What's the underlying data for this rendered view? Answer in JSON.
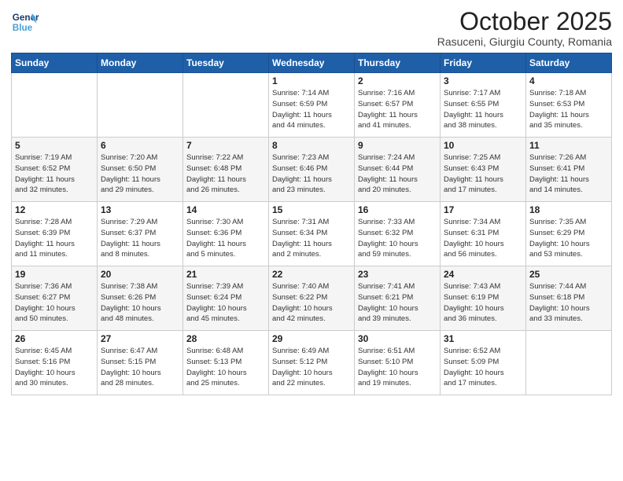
{
  "logo": {
    "line1": "General",
    "line2": "Blue"
  },
  "header": {
    "month": "October 2025",
    "location": "Rasuceni, Giurgiu County, Romania"
  },
  "weekdays": [
    "Sunday",
    "Monday",
    "Tuesday",
    "Wednesday",
    "Thursday",
    "Friday",
    "Saturday"
  ],
  "weeks": [
    [
      {
        "day": "",
        "info": ""
      },
      {
        "day": "",
        "info": ""
      },
      {
        "day": "",
        "info": ""
      },
      {
        "day": "1",
        "info": "Sunrise: 7:14 AM\nSunset: 6:59 PM\nDaylight: 11 hours\nand 44 minutes."
      },
      {
        "day": "2",
        "info": "Sunrise: 7:16 AM\nSunset: 6:57 PM\nDaylight: 11 hours\nand 41 minutes."
      },
      {
        "day": "3",
        "info": "Sunrise: 7:17 AM\nSunset: 6:55 PM\nDaylight: 11 hours\nand 38 minutes."
      },
      {
        "day": "4",
        "info": "Sunrise: 7:18 AM\nSunset: 6:53 PM\nDaylight: 11 hours\nand 35 minutes."
      }
    ],
    [
      {
        "day": "5",
        "info": "Sunrise: 7:19 AM\nSunset: 6:52 PM\nDaylight: 11 hours\nand 32 minutes."
      },
      {
        "day": "6",
        "info": "Sunrise: 7:20 AM\nSunset: 6:50 PM\nDaylight: 11 hours\nand 29 minutes."
      },
      {
        "day": "7",
        "info": "Sunrise: 7:22 AM\nSunset: 6:48 PM\nDaylight: 11 hours\nand 26 minutes."
      },
      {
        "day": "8",
        "info": "Sunrise: 7:23 AM\nSunset: 6:46 PM\nDaylight: 11 hours\nand 23 minutes."
      },
      {
        "day": "9",
        "info": "Sunrise: 7:24 AM\nSunset: 6:44 PM\nDaylight: 11 hours\nand 20 minutes."
      },
      {
        "day": "10",
        "info": "Sunrise: 7:25 AM\nSunset: 6:43 PM\nDaylight: 11 hours\nand 17 minutes."
      },
      {
        "day": "11",
        "info": "Sunrise: 7:26 AM\nSunset: 6:41 PM\nDaylight: 11 hours\nand 14 minutes."
      }
    ],
    [
      {
        "day": "12",
        "info": "Sunrise: 7:28 AM\nSunset: 6:39 PM\nDaylight: 11 hours\nand 11 minutes."
      },
      {
        "day": "13",
        "info": "Sunrise: 7:29 AM\nSunset: 6:37 PM\nDaylight: 11 hours\nand 8 minutes."
      },
      {
        "day": "14",
        "info": "Sunrise: 7:30 AM\nSunset: 6:36 PM\nDaylight: 11 hours\nand 5 minutes."
      },
      {
        "day": "15",
        "info": "Sunrise: 7:31 AM\nSunset: 6:34 PM\nDaylight: 11 hours\nand 2 minutes."
      },
      {
        "day": "16",
        "info": "Sunrise: 7:33 AM\nSunset: 6:32 PM\nDaylight: 10 hours\nand 59 minutes."
      },
      {
        "day": "17",
        "info": "Sunrise: 7:34 AM\nSunset: 6:31 PM\nDaylight: 10 hours\nand 56 minutes."
      },
      {
        "day": "18",
        "info": "Sunrise: 7:35 AM\nSunset: 6:29 PM\nDaylight: 10 hours\nand 53 minutes."
      }
    ],
    [
      {
        "day": "19",
        "info": "Sunrise: 7:36 AM\nSunset: 6:27 PM\nDaylight: 10 hours\nand 50 minutes."
      },
      {
        "day": "20",
        "info": "Sunrise: 7:38 AM\nSunset: 6:26 PM\nDaylight: 10 hours\nand 48 minutes."
      },
      {
        "day": "21",
        "info": "Sunrise: 7:39 AM\nSunset: 6:24 PM\nDaylight: 10 hours\nand 45 minutes."
      },
      {
        "day": "22",
        "info": "Sunrise: 7:40 AM\nSunset: 6:22 PM\nDaylight: 10 hours\nand 42 minutes."
      },
      {
        "day": "23",
        "info": "Sunrise: 7:41 AM\nSunset: 6:21 PM\nDaylight: 10 hours\nand 39 minutes."
      },
      {
        "day": "24",
        "info": "Sunrise: 7:43 AM\nSunset: 6:19 PM\nDaylight: 10 hours\nand 36 minutes."
      },
      {
        "day": "25",
        "info": "Sunrise: 7:44 AM\nSunset: 6:18 PM\nDaylight: 10 hours\nand 33 minutes."
      }
    ],
    [
      {
        "day": "26",
        "info": "Sunrise: 6:45 AM\nSunset: 5:16 PM\nDaylight: 10 hours\nand 30 minutes."
      },
      {
        "day": "27",
        "info": "Sunrise: 6:47 AM\nSunset: 5:15 PM\nDaylight: 10 hours\nand 28 minutes."
      },
      {
        "day": "28",
        "info": "Sunrise: 6:48 AM\nSunset: 5:13 PM\nDaylight: 10 hours\nand 25 minutes."
      },
      {
        "day": "29",
        "info": "Sunrise: 6:49 AM\nSunset: 5:12 PM\nDaylight: 10 hours\nand 22 minutes."
      },
      {
        "day": "30",
        "info": "Sunrise: 6:51 AM\nSunset: 5:10 PM\nDaylight: 10 hours\nand 19 minutes."
      },
      {
        "day": "31",
        "info": "Sunrise: 6:52 AM\nSunset: 5:09 PM\nDaylight: 10 hours\nand 17 minutes."
      },
      {
        "day": "",
        "info": ""
      }
    ]
  ]
}
